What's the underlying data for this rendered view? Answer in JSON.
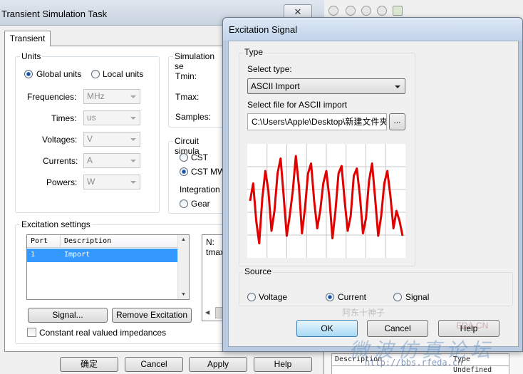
{
  "task_window": {
    "title": "Transient Simulation Task",
    "close_glyph": "✕",
    "tab": "Transient",
    "units": {
      "group_title": "Units",
      "global_units": "Global units",
      "local_units": "Local units",
      "frequencies_label": "Frequencies:",
      "frequencies_value": "MHz",
      "times_label": "Times:",
      "times_value": "us",
      "voltages_label": "Voltages:",
      "voltages_value": "V",
      "currents_label": "Currents:",
      "currents_value": "A",
      "powers_label": "Powers:",
      "powers_value": "W"
    },
    "simulation": {
      "group_title": "Simulation se",
      "tmin_label": "Tmin:",
      "tmax_label": "Tmax:",
      "samples_label": "Samples:"
    },
    "circuit": {
      "group_title": "Circuit simula",
      "cst": "CST",
      "cst_mw": "CST MW",
      "integration": "Integration",
      "gear": "Gear"
    },
    "excitation": {
      "group_title": "Excitation settings",
      "col_port": "Port",
      "col_description": "Description",
      "row_port": "1",
      "row_description": "Import",
      "info_n": "N:",
      "info_tmax": "tmax",
      "signal_button": "Signal...",
      "remove_button": "Remove Excitation",
      "constant_impedances": "Constant real valued impedances"
    },
    "buttons": {
      "ok": "确定",
      "cancel": "Cancel",
      "apply": "Apply",
      "help": "Help"
    }
  },
  "excitation_dialog": {
    "title": "Excitation Signal",
    "type_group": "Type",
    "select_type_label": "Select type:",
    "select_type_value": "ASCII Import",
    "select_file_label": "Select file for ASCII import",
    "file_path": "C:\\Users\\Apple\\Desktop\\新建文件夹",
    "browse_label": "...",
    "source_group": "Source",
    "source_voltage": "Voltage",
    "source_current": "Current",
    "source_signal": "Signal",
    "ok": "OK",
    "cancel": "Cancel",
    "help": "Help"
  },
  "background": {
    "table_col_description": "Description",
    "table_col_type": "Type",
    "table_cell_type": "Undefined",
    "watermark_1": "阿东十神子",
    "watermark_2": "EDA.CN",
    "watermark_3": "微波仿真论坛",
    "watermark_url": "http://bbs.rfeda.cn"
  },
  "chart_data": {
    "type": "line",
    "series_color": "#e00000",
    "grid": true,
    "xlim": [
      0,
      1
    ],
    "ylim": [
      -1,
      1
    ],
    "x": [
      0,
      0.02,
      0.04,
      0.06,
      0.08,
      0.1,
      0.12,
      0.14,
      0.16,
      0.18,
      0.2,
      0.22,
      0.24,
      0.26,
      0.28,
      0.3,
      0.32,
      0.34,
      0.36,
      0.38,
      0.4,
      0.42,
      0.44,
      0.46,
      0.48,
      0.5,
      0.52,
      0.54,
      0.56,
      0.58,
      0.6,
      0.62,
      0.64,
      0.66,
      0.68,
      0.7,
      0.72,
      0.74,
      0.76,
      0.78,
      0.8,
      0.82,
      0.84,
      0.86,
      0.88,
      0.9,
      0.92,
      0.94,
      0.96,
      0.98,
      1.0
    ],
    "values": [
      0.0,
      0.35,
      -0.4,
      -0.85,
      0.05,
      0.6,
      0.2,
      -0.6,
      -0.2,
      0.55,
      0.85,
      0.1,
      -0.7,
      -0.3,
      0.2,
      0.9,
      0.3,
      -0.65,
      -0.15,
      0.55,
      0.75,
      0.0,
      -0.55,
      -0.2,
      0.35,
      0.6,
      0.05,
      -0.75,
      -0.2,
      0.55,
      0.7,
      0.0,
      -0.6,
      -0.3,
      0.5,
      0.65,
      0.1,
      -0.65,
      -0.35,
      0.4,
      0.75,
      0.05,
      -0.7,
      -0.3,
      0.35,
      0.6,
      0.1,
      -0.55,
      -0.2,
      -0.4,
      -0.7
    ]
  }
}
